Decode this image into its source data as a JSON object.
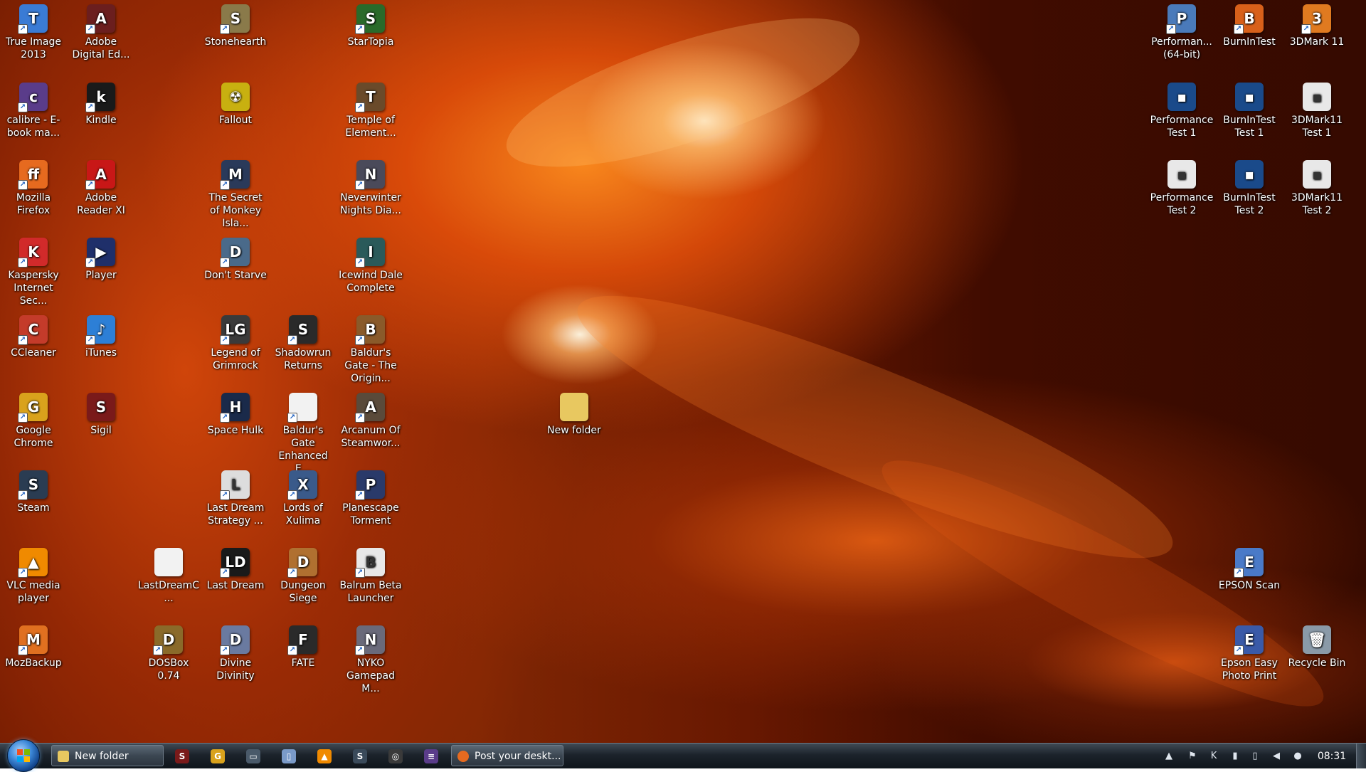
{
  "desktop": {
    "icons": [
      {
        "id": "true-image",
        "label": "True Image 2013",
        "glyph": "T",
        "color": "#3a7bd5",
        "shortcut": true
      },
      {
        "id": "calibre",
        "label": "calibre - E-book ma...",
        "glyph": "c",
        "color": "#5a3c8a",
        "shortcut": true
      },
      {
        "id": "mozilla-firefox",
        "label": "Mozilla Firefox",
        "glyph": "ff",
        "color": "#e66a1f",
        "shortcut": true
      },
      {
        "id": "kaspersky",
        "label": "Kaspersky Internet Sec...",
        "glyph": "K",
        "color": "#d12a2a",
        "shortcut": true
      },
      {
        "id": "ccleaner",
        "label": "CCleaner",
        "glyph": "C",
        "color": "#c43b2a",
        "shortcut": true
      },
      {
        "id": "google-chrome",
        "label": "Google Chrome",
        "glyph": "G",
        "color": "#d9a21c",
        "shortcut": true
      },
      {
        "id": "steam",
        "label": "Steam",
        "glyph": "S",
        "color": "#2a3c52",
        "shortcut": true
      },
      {
        "id": "vlc",
        "label": "VLC media player",
        "glyph": "▲",
        "color": "#f08a00",
        "shortcut": true
      },
      {
        "id": "mozbackup",
        "label": "MozBackup",
        "glyph": "M",
        "color": "#e07020",
        "shortcut": true
      },
      {
        "id": "adobe-digital-ed",
        "label": "Adobe Digital Ed...",
        "glyph": "A",
        "color": "#6b1e1e",
        "shortcut": true
      },
      {
        "id": "kindle",
        "label": "Kindle",
        "glyph": "k",
        "color": "#1a1a1a",
        "shortcut": true
      },
      {
        "id": "adobe-reader",
        "label": "Adobe Reader XI",
        "glyph": "A",
        "color": "#c81717",
        "shortcut": true
      },
      {
        "id": "player",
        "label": "Player",
        "glyph": "▶",
        "color": "#1f2f6a",
        "shortcut": true
      },
      {
        "id": "itunes",
        "label": "iTunes",
        "glyph": "♪",
        "color": "#2d7fd6",
        "shortcut": true
      },
      {
        "id": "sigil",
        "label": "Sigil",
        "glyph": "S",
        "color": "#7a1a1a",
        "shortcut": false
      },
      {
        "id": "stonehearth",
        "label": "Stonehearth",
        "glyph": "S",
        "color": "#8a7a4a",
        "shortcut": true
      },
      {
        "id": "fallout",
        "label": "Fallout",
        "glyph": "☢",
        "color": "#c8b010",
        "shortcut": false
      },
      {
        "id": "monkey-island",
        "label": "The Secret of Monkey Isla...",
        "glyph": "M",
        "color": "#2a3a5a",
        "shortcut": true
      },
      {
        "id": "dont-starve",
        "label": "Don't Starve",
        "glyph": "D",
        "color": "#4a6a8a",
        "shortcut": true
      },
      {
        "id": "legend-of-grimrock",
        "label": "Legend of Grimrock",
        "glyph": "LG",
        "color": "#3a3a3a",
        "shortcut": true
      },
      {
        "id": "space-hulk",
        "label": "Space Hulk",
        "glyph": "H",
        "color": "#1a2a4a",
        "shortcut": true
      },
      {
        "id": "last-dream-strategy",
        "label": "Last Dream Strategy ...",
        "glyph": "L",
        "color": "#ddd",
        "shortcut": true
      },
      {
        "id": "last-dream-c",
        "label": "LastDreamC...",
        "glyph": "",
        "color": "#f2f2f2",
        "shortcut": false
      },
      {
        "id": "last-dream",
        "label": "Last Dream",
        "glyph": "LD",
        "color": "#1a1a1a",
        "shortcut": true
      },
      {
        "id": "dosbox",
        "label": "DOSBox 0.74",
        "glyph": "D",
        "color": "#8a6a2a",
        "shortcut": true
      },
      {
        "id": "divine-divinity",
        "label": "Divine Divinity",
        "glyph": "D",
        "color": "#6a7aa0",
        "shortcut": true
      },
      {
        "id": "shadowrun-returns",
        "label": "Shadowrun Returns",
        "glyph": "S",
        "color": "#2a2a2a",
        "shortcut": true
      },
      {
        "id": "baldurs-gate-ee",
        "label": "Baldur's Gate Enhanced E...",
        "glyph": "",
        "color": "#f2f2f2",
        "shortcut": true
      },
      {
        "id": "lords-of-xulima",
        "label": "Lords of Xulima",
        "glyph": "X",
        "color": "#3a5a8a",
        "shortcut": true
      },
      {
        "id": "dungeon-siege",
        "label": "Dungeon Siege",
        "glyph": "D",
        "color": "#b07030",
        "shortcut": true
      },
      {
        "id": "fate",
        "label": "FATE",
        "glyph": "F",
        "color": "#2a2a2a",
        "shortcut": true
      },
      {
        "id": "startopia",
        "label": "StarTopia",
        "glyph": "S",
        "color": "#2a6a2a",
        "shortcut": true
      },
      {
        "id": "temple-of-elemental",
        "label": "Temple of Element...",
        "glyph": "T",
        "color": "#6a4a2a",
        "shortcut": true
      },
      {
        "id": "neverwinter-nights",
        "label": "Neverwinter Nights Dia...",
        "glyph": "N",
        "color": "#4a4a5a",
        "shortcut": true
      },
      {
        "id": "icewind-dale",
        "label": "Icewind Dale Complete",
        "glyph": "I",
        "color": "#2a5a5a",
        "shortcut": true
      },
      {
        "id": "baldurs-gate-origin",
        "label": "Baldur's Gate - The Origin...",
        "glyph": "B",
        "color": "#8a5a2a",
        "shortcut": true
      },
      {
        "id": "arcanum",
        "label": "Arcanum Of Steamwor...",
        "glyph": "A",
        "color": "#5a4a3a",
        "shortcut": true
      },
      {
        "id": "planescape-torment",
        "label": "Planescape Torment",
        "glyph": "P",
        "color": "#2a3a6a",
        "shortcut": true
      },
      {
        "id": "balrum-beta",
        "label": "Balrum Beta Launcher",
        "glyph": "B",
        "color": "#e8e8e8",
        "shortcut": true
      },
      {
        "id": "nyko-gamepad",
        "label": "NYKO Gamepad M...",
        "glyph": "N",
        "color": "#6a6a7a",
        "shortcut": true
      },
      {
        "id": "new-folder",
        "label": "New folder",
        "glyph": "",
        "color": "#e8c860",
        "shortcut": false
      },
      {
        "id": "performance-64",
        "label": "Performan... (64-bit)",
        "glyph": "P",
        "color": "#4a7aba",
        "shortcut": true
      },
      {
        "id": "performance-test-1",
        "label": "Performance Test 1",
        "glyph": "▪",
        "color": "#1a4a8a",
        "shortcut": false
      },
      {
        "id": "performance-test-2",
        "label": "Performance Test 2",
        "glyph": "▪",
        "color": "#e8e8e8",
        "shortcut": false
      },
      {
        "id": "burnintest",
        "label": "BurnInTest",
        "glyph": "B",
        "color": "#d8601a",
        "shortcut": true
      },
      {
        "id": "burnintest-test-1",
        "label": "BurnInTest Test 1",
        "glyph": "▪",
        "color": "#1a4a8a",
        "shortcut": false
      },
      {
        "id": "burnintest-test-2",
        "label": "BurnInTest Test 2",
        "glyph": "▪",
        "color": "#1a4a8a",
        "shortcut": false
      },
      {
        "id": "3dmark-11",
        "label": "3DMark 11",
        "glyph": "3",
        "color": "#e07a20",
        "shortcut": true
      },
      {
        "id": "3dmark11-test-1",
        "label": "3DMark11 Test 1",
        "glyph": "▪",
        "color": "#e8e8e8",
        "shortcut": false
      },
      {
        "id": "3dmark11-test-2",
        "label": "3DMark11 Test 2",
        "glyph": "▪",
        "color": "#e8e8e8",
        "shortcut": false
      },
      {
        "id": "epson-scan",
        "label": "EPSON Scan",
        "glyph": "E",
        "color": "#4a7ac8",
        "shortcut": true
      },
      {
        "id": "epson-easy-photo",
        "label": "Epson Easy Photo Print",
        "glyph": "E",
        "color": "#3a5aa8",
        "shortcut": true
      },
      {
        "id": "recycle-bin",
        "label": "Recycle Bin",
        "glyph": "🗑",
        "color": "#8a9aa8",
        "shortcut": false
      }
    ]
  },
  "taskbar": {
    "start_label": "Start",
    "windows": [
      {
        "id": "new-folder",
        "label": "New folder",
        "icon_color": "#e8c860"
      },
      {
        "id": "post-your-desktop",
        "label": "Post your deskt...",
        "icon_color": "#e66a1f"
      }
    ],
    "pinned": [
      {
        "id": "sigil",
        "glyph": "S",
        "color": "#7a1a1a"
      },
      {
        "id": "chrome",
        "glyph": "G",
        "color": "#d9a21c"
      },
      {
        "id": "app-window",
        "glyph": "▭",
        "color": "#4a5a6a"
      },
      {
        "id": "document",
        "glyph": "▯",
        "color": "#7a9ac8"
      },
      {
        "id": "vlc",
        "glyph": "▲",
        "color": "#f08a00"
      },
      {
        "id": "steam",
        "glyph": "S",
        "color": "#3a4a5a"
      },
      {
        "id": "startopia",
        "glyph": "◎",
        "color": "#3a3a3a"
      },
      {
        "id": "calibre",
        "glyph": "≡",
        "color": "#5a3c8a"
      }
    ],
    "tray": [
      {
        "id": "show-hidden",
        "glyph": "▲"
      },
      {
        "id": "action-center",
        "glyph": "⚑"
      },
      {
        "id": "kaspersky",
        "glyph": "K"
      },
      {
        "id": "network",
        "glyph": "▮"
      },
      {
        "id": "safely-remove",
        "glyph": "▯"
      },
      {
        "id": "volume",
        "glyph": "◀"
      },
      {
        "id": "update",
        "glyph": "●"
      }
    ],
    "clock": "08:31"
  }
}
